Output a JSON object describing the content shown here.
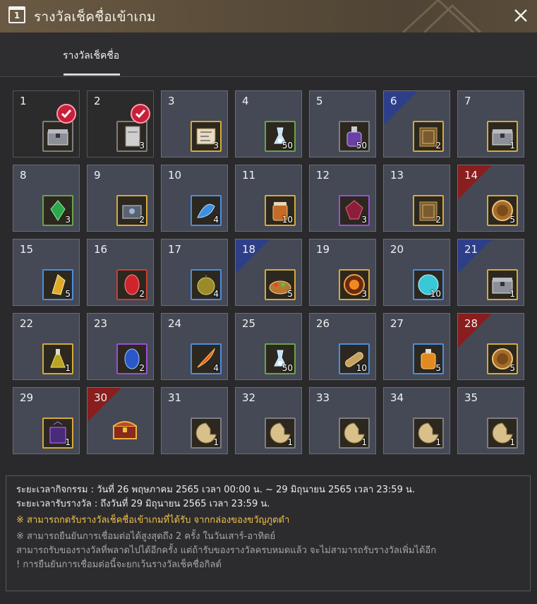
{
  "window": {
    "title": "รางวัลเช็คชื่อเข้าเกม",
    "calendar_icon_text": "1"
  },
  "tabs": [
    {
      "label": "รางวัลเช็คชื่อ",
      "active": true
    }
  ],
  "colors": {
    "accent_gold": "#d3aa3b",
    "claimed_check": "#c81f3b",
    "ribbon_blue": "#2e3f8a",
    "ribbon_red": "#8a1d1d",
    "notice_yellow": "#f2c24a"
  },
  "rewards": [
    {
      "day": "1",
      "qty": "",
      "icon": "silver-chest-icon",
      "frame": "grey",
      "claimed": true,
      "ribbon": ""
    },
    {
      "day": "2",
      "qty": "3",
      "icon": "scroll-card-icon",
      "frame": "grey",
      "claimed": true,
      "ribbon": ""
    },
    {
      "day": "3",
      "qty": "3",
      "icon": "map-scroll-icon",
      "frame": "gold",
      "claimed": false,
      "ribbon": ""
    },
    {
      "day": "4",
      "qty": "50",
      "icon": "potion-vial-icon",
      "frame": "green",
      "claimed": false,
      "ribbon": ""
    },
    {
      "day": "5",
      "qty": "50",
      "icon": "purple-bottle-icon",
      "frame": "grey",
      "claimed": false,
      "ribbon": ""
    },
    {
      "day": "6",
      "qty": "2",
      "icon": "book-icon",
      "frame": "gold",
      "claimed": false,
      "ribbon": "blue"
    },
    {
      "day": "7",
      "qty": "1",
      "icon": "silver-chest-icon",
      "frame": "gold",
      "claimed": false,
      "ribbon": ""
    },
    {
      "day": "8",
      "qty": "3",
      "icon": "green-crystal-icon",
      "frame": "green",
      "claimed": false,
      "ribbon": ""
    },
    {
      "day": "9",
      "qty": "2",
      "icon": "steel-chest-icon",
      "frame": "gold",
      "claimed": false,
      "ribbon": ""
    },
    {
      "day": "10",
      "qty": "4",
      "icon": "blue-shell-icon",
      "frame": "blue",
      "claimed": false,
      "ribbon": ""
    },
    {
      "day": "11",
      "qty": "10",
      "icon": "honey-jar-icon",
      "frame": "gold",
      "claimed": false,
      "ribbon": ""
    },
    {
      "day": "12",
      "qty": "3",
      "icon": "red-gem-icon",
      "frame": "purple",
      "claimed": false,
      "ribbon": ""
    },
    {
      "day": "13",
      "qty": "2",
      "icon": "book-icon",
      "frame": "gold",
      "claimed": false,
      "ribbon": ""
    },
    {
      "day": "14",
      "qty": "5",
      "icon": "horse-coin-icon",
      "frame": "gold",
      "claimed": false,
      "ribbon": "red"
    },
    {
      "day": "15",
      "qty": "5",
      "icon": "gold-crystal-icon",
      "frame": "blue",
      "claimed": false,
      "ribbon": ""
    },
    {
      "day": "16",
      "qty": "2",
      "icon": "ruby-icon",
      "frame": "red",
      "claimed": false,
      "ribbon": ""
    },
    {
      "day": "17",
      "qty": "4",
      "icon": "durian-icon",
      "frame": "blue",
      "claimed": false,
      "ribbon": ""
    },
    {
      "day": "18",
      "qty": "5",
      "icon": "food-platter-icon",
      "frame": "gold",
      "claimed": false,
      "ribbon": "blue"
    },
    {
      "day": "19",
      "qty": "3",
      "icon": "fire-orb-icon",
      "frame": "gold",
      "claimed": false,
      "ribbon": ""
    },
    {
      "day": "20",
      "qty": "10",
      "icon": "moon-orb-icon",
      "frame": "blue",
      "claimed": false,
      "ribbon": ""
    },
    {
      "day": "21",
      "qty": "1",
      "icon": "silver-chest-icon",
      "frame": "gold",
      "claimed": false,
      "ribbon": "blue"
    },
    {
      "day": "22",
      "qty": "1",
      "icon": "yellow-potion-icon",
      "frame": "gold",
      "claimed": false,
      "ribbon": ""
    },
    {
      "day": "23",
      "qty": "2",
      "icon": "blue-gem-icon",
      "frame": "purple",
      "claimed": false,
      "ribbon": ""
    },
    {
      "day": "24",
      "qty": "4",
      "icon": "fire-feather-icon",
      "frame": "blue",
      "claimed": false,
      "ribbon": ""
    },
    {
      "day": "25",
      "qty": "50",
      "icon": "potion-vial-icon",
      "frame": "green",
      "claimed": false,
      "ribbon": ""
    },
    {
      "day": "26",
      "qty": "10",
      "icon": "scroll-roll-icon",
      "frame": "blue",
      "claimed": false,
      "ribbon": ""
    },
    {
      "day": "27",
      "qty": "5",
      "icon": "orange-potion-icon",
      "frame": "blue",
      "claimed": false,
      "ribbon": ""
    },
    {
      "day": "28",
      "qty": "5",
      "icon": "horse-coin-icon",
      "frame": "gold",
      "claimed": false,
      "ribbon": "red"
    },
    {
      "day": "29",
      "qty": "1",
      "icon": "purple-box-icon",
      "frame": "gold",
      "claimed": false,
      "ribbon": ""
    },
    {
      "day": "30",
      "qty": "",
      "icon": "treasure-chest-icon",
      "frame": "none",
      "claimed": false,
      "ribbon": "red"
    },
    {
      "day": "31",
      "qty": "1",
      "icon": "cookie-icon",
      "frame": "grey",
      "claimed": false,
      "ribbon": ""
    },
    {
      "day": "32",
      "qty": "1",
      "icon": "cookie-icon",
      "frame": "grey",
      "claimed": false,
      "ribbon": ""
    },
    {
      "day": "33",
      "qty": "1",
      "icon": "cookie-icon",
      "frame": "grey",
      "claimed": false,
      "ribbon": ""
    },
    {
      "day": "34",
      "qty": "1",
      "icon": "cookie-icon",
      "frame": "grey",
      "claimed": false,
      "ribbon": ""
    },
    {
      "day": "35",
      "qty": "1",
      "icon": "cookie-icon",
      "frame": "grey",
      "claimed": false,
      "ribbon": ""
    }
  ],
  "info": {
    "event_period": "ระยะเวลากิจกรรม : วันที่ 26 พฤษภาคม 2565 เวลา 00:00 น. ~ 29 มิถุนายน 2565 เวลา 23:59 น.",
    "claim_period": "ระยะเวลารับรางวัล : ถึงวันที่ 29 มิถุนายน 2565 เวลา 23:59 น.",
    "note_mailbox": "※ สามารถกดรับรางวัลเช็คชื่อเข้าเกมที่ได้รับ จากกล่องของขวัญภูตดำ",
    "note_rules_1": "※ สามารถยืนยันการเชื่อมต่อได้สูงสุดถึง 2 ครั้ง ในวันเสาร์-อาทิตย์",
    "note_rules_2": "สามารถรับของรางวัลที่พลาดไปได้อีกครั้ง แต่ถ้ารับของรางวัลครบหมดแล้ว จะไม่สามารถรับรางวัลเพิ่มได้อีก",
    "note_rules_3": "! การยืนยันการเชื่อมต่อนี้จะยกเว้นรางวัลเช็คชื่อกิลด์"
  }
}
